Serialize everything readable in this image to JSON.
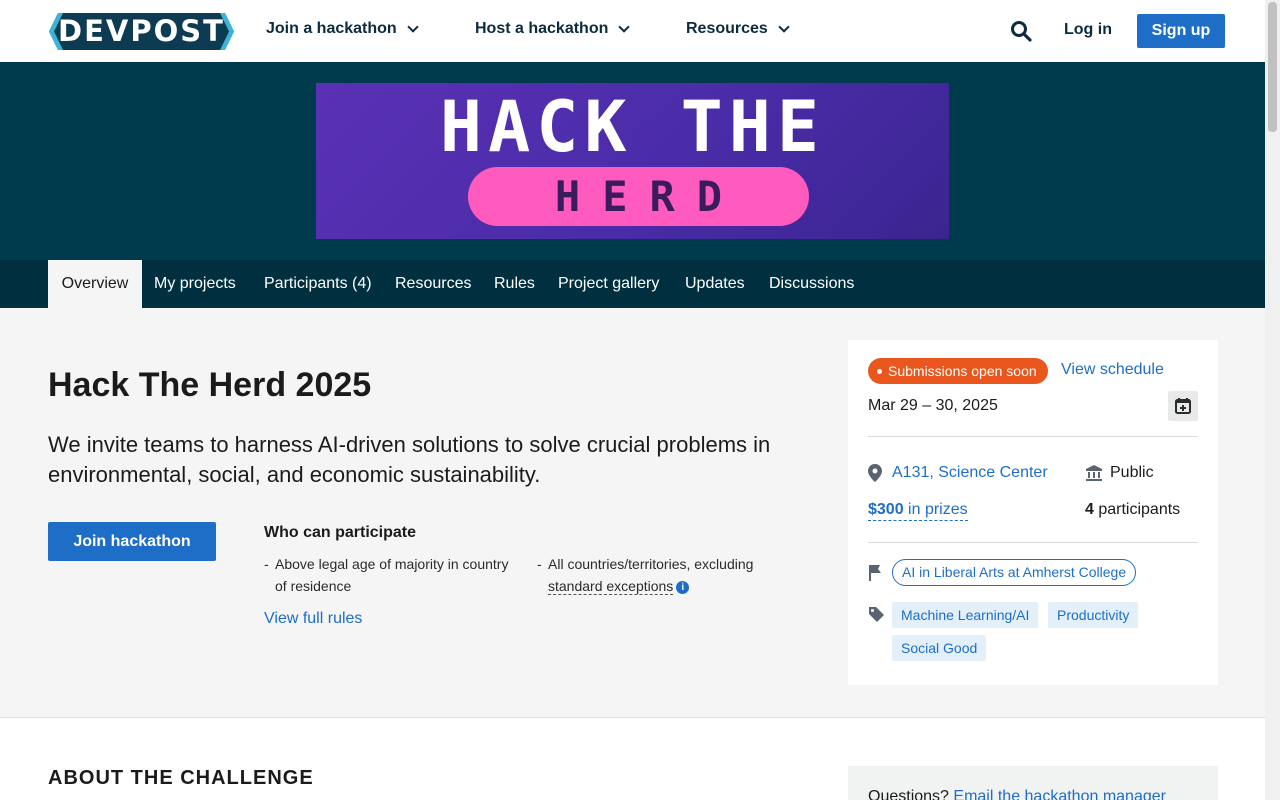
{
  "header": {
    "logo_text": "DEVPOST",
    "nav": [
      "Join a hackathon",
      "Host a hackathon",
      "Resources"
    ],
    "login": "Log in",
    "signup": "Sign up"
  },
  "banner": {
    "line1": "HACK THE",
    "line2": "HERD"
  },
  "tabs": [
    "Overview",
    "My projects",
    "Participants (4)",
    "Resources",
    "Rules",
    "Project gallery",
    "Updates",
    "Discussions"
  ],
  "active_tab": "Overview",
  "main": {
    "title": "Hack The Herd 2025",
    "tagline": "We invite teams to harness AI-driven solutions to solve crucial problems in environmental, social, and economic sustainability.",
    "join_button": "Join hackathon",
    "who_title": "Who can participate",
    "who_items": [
      "Above legal age of majority in country of residence",
      "All countries/territories, excluding"
    ],
    "standard_exceptions": "standard exceptions",
    "view_rules": "View full rules"
  },
  "sidebar": {
    "status": "Submissions open soon",
    "view_schedule": "View schedule",
    "dates": "Mar 29 – 30, 2025",
    "location": "A131, Science Center",
    "visibility": "Public",
    "prize_amount": "$300",
    "prize_suffix": " in prizes",
    "participant_count": "4",
    "participant_label": " participants",
    "organizer": "AI in Liberal Arts at Amherst College",
    "tags": [
      "Machine Learning/AI",
      "Productivity",
      "Social Good"
    ]
  },
  "lower": {
    "about_heading": "ABOUT THE CHALLENGE",
    "questions_label": "Questions? ",
    "questions_link": "Email the hackathon manager"
  },
  "colors": {
    "brand_dark": "#003b4d",
    "accent_blue": "#1e6ec8",
    "status_orange": "#e9571f"
  }
}
